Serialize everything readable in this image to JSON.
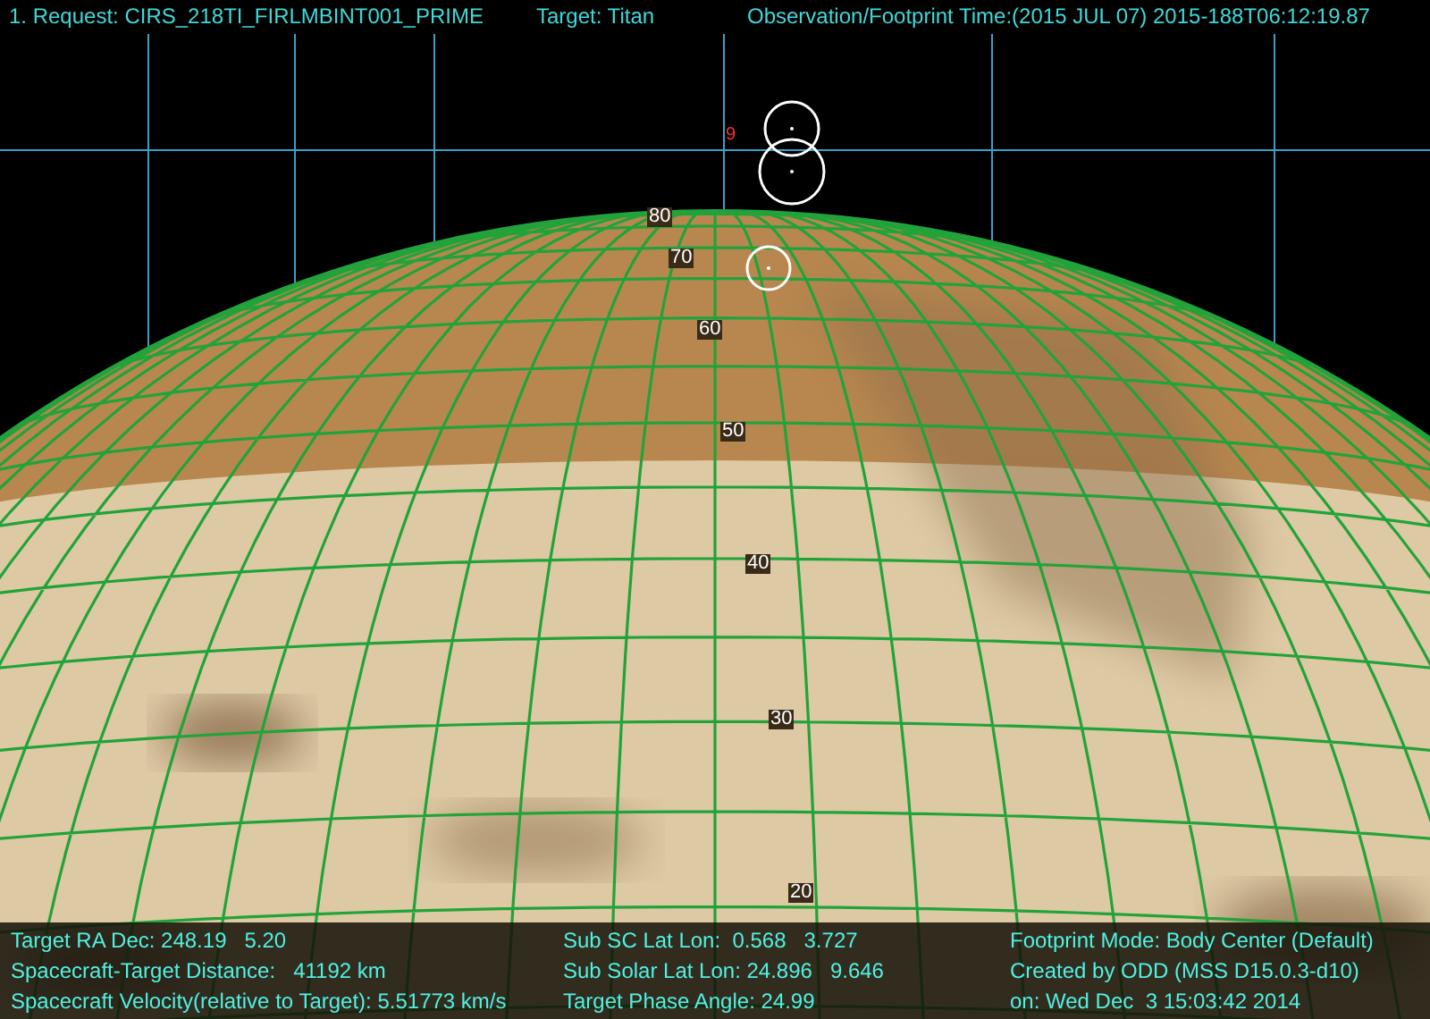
{
  "header": {
    "request": "1. Request: CIRS_218TI_FIRLMBINT001_PRIME",
    "target": "Target: Titan",
    "observation_time": "Observation/Footprint Time:(2015 JUL 07) 2015-188T06:12:19.87"
  },
  "globe": {
    "latitude_labels": [
      "80",
      "70",
      "60",
      "50",
      "40",
      "30",
      "20"
    ],
    "footprint_number": "9"
  },
  "info": {
    "left": [
      "Target RA Dec: 248.19   5.20",
      "Spacecraft-Target Distance:   41192 km",
      "Spacecraft Velocity(relative to Target): 5.51773 km/s"
    ],
    "middle": [
      "Sub SC Lat Lon:  0.568   3.727",
      "Sub Solar Lat Lon: 24.896   9.646",
      "Target Phase Angle: 24.99"
    ],
    "right": [
      "Footprint Mode: Body Center (Default)",
      "Created by ODD (MSS D15.0.3-d10)",
      "on: Wed Dec  3 15:03:42 2014"
    ]
  }
}
